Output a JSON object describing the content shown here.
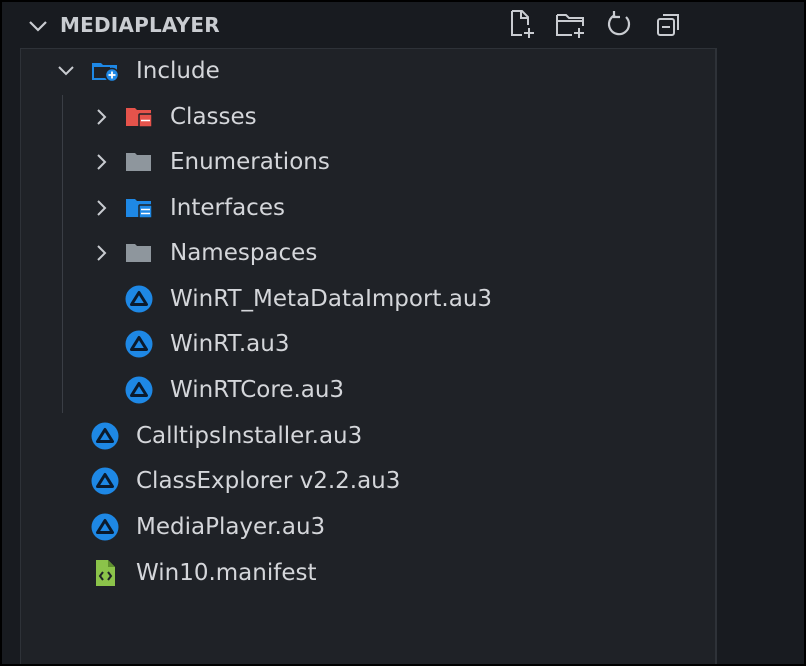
{
  "explorer": {
    "title": "MEDIAPLAYER",
    "actions": [
      {
        "name": "new-file-icon"
      },
      {
        "name": "new-folder-icon"
      },
      {
        "name": "refresh-icon"
      },
      {
        "name": "collapse-all-icon"
      }
    ]
  },
  "tree": {
    "include": {
      "label": "Include",
      "icon": "folder-plus-blue"
    },
    "include_children": [
      {
        "label": "Classes",
        "icon": "folder-red",
        "expandable": true
      },
      {
        "label": "Enumerations",
        "icon": "folder-gray",
        "expandable": true
      },
      {
        "label": "Interfaces",
        "icon": "folder-blue",
        "expandable": true
      },
      {
        "label": "Namespaces",
        "icon": "folder-gray",
        "expandable": true
      },
      {
        "label": "WinRT_MetaDataImport.au3",
        "icon": "autoit-file"
      },
      {
        "label": "WinRT.au3",
        "icon": "autoit-file"
      },
      {
        "label": "WinRTCore.au3",
        "icon": "autoit-file"
      }
    ],
    "root_files": [
      {
        "label": "CalltipsInstaller.au3",
        "icon": "autoit-file"
      },
      {
        "label": "ClassExplorer v2.2.au3",
        "icon": "autoit-file"
      },
      {
        "label": "MediaPlayer.au3",
        "icon": "autoit-file"
      },
      {
        "label": "Win10.manifest",
        "icon": "manifest-file"
      }
    ]
  },
  "colors": {
    "background": "#1f2227",
    "text": "#d4d6da",
    "accent_blue": "#1e88e5",
    "folder_red": "#e5534b",
    "folder_gray": "#8e969d",
    "manifest_green": "#8bc34a"
  }
}
